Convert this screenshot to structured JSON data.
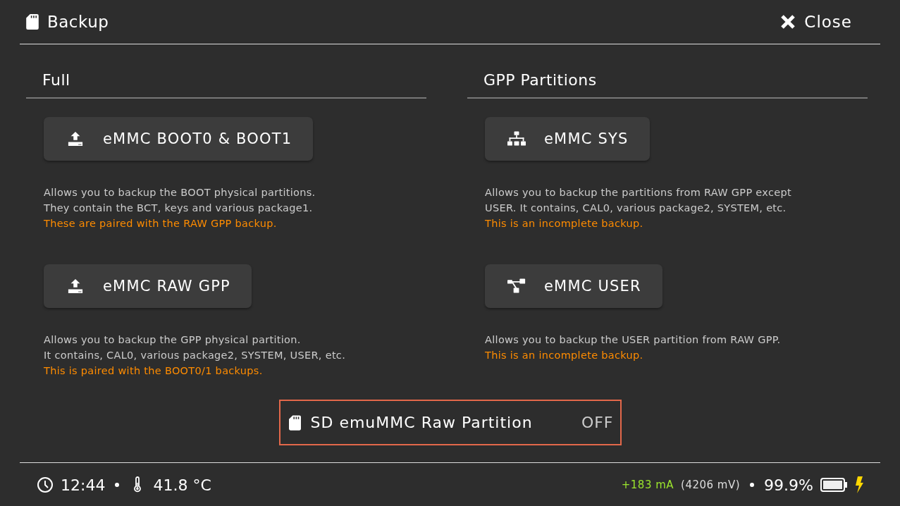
{
  "header": {
    "title": "Backup",
    "close": "Close"
  },
  "sections": [
    {
      "title": "Full",
      "items": [
        {
          "kind": "upload",
          "label": "eMMC BOOT0 & BOOT1",
          "description": [
            "Allows you to backup the BOOT physical partitions.",
            "They contain the BCT, keys and various package1."
          ],
          "note": "These are paired with the RAW GPP backup."
        },
        {
          "kind": "upload",
          "label": "eMMC RAW GPP",
          "description": [
            "Allows you to backup the GPP physical partition.",
            "It contains, CAL0, various package2, SYSTEM, USER, etc."
          ],
          "note": "This is paired with the BOOT0/1 backups."
        }
      ]
    },
    {
      "title": "GPP Partitions",
      "items": [
        {
          "kind": "hierarchy",
          "label": "eMMC SYS",
          "description": [
            "Allows you to backup the partitions from RAW GPP except",
            "USER. It contains, CAL0, various package2, SYSTEM, etc."
          ],
          "note": "This is an incomplete backup."
        },
        {
          "kind": "branch",
          "label": "eMMC USER",
          "description": [
            "Allows you to backup the USER partition from RAW GPP."
          ],
          "note": "This is an incomplete backup."
        }
      ]
    }
  ],
  "toggle": {
    "label": "SD emuMMC Raw Partition",
    "value": "OFF",
    "selected": true
  },
  "status_bar": {
    "time": "12:44",
    "temperature": "41.8 °C",
    "current": "+183 mA",
    "voltage": "(4206 mV)",
    "battery": "99.9%",
    "charging": true
  }
}
